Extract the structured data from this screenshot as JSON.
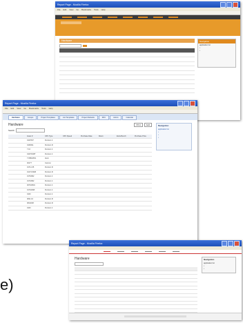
{
  "windows": {
    "top": {
      "title": "Report Page - Mozilla Firefox",
      "menu": [
        "File",
        "Edit",
        "View",
        "Go",
        "Bookmarks",
        "Tools",
        "Help"
      ],
      "section_title": "Hardware",
      "sidebar": {
        "title": "Navigation",
        "items": [
          "application list",
          "",
          ""
        ]
      }
    },
    "middle": {
      "title": "Report Page - Mozilla Firefox",
      "menu": [
        "File",
        "Edit",
        "View",
        "Go",
        "Bookmarks",
        "Tools",
        "Help"
      ],
      "tabs": [
        "Hardware",
        "Groups",
        "Project Templates",
        "List Templates",
        "Project Defaults",
        "RFC",
        "Admin",
        "Calendar"
      ],
      "section_title": "Hardware",
      "search_label": "Search",
      "buttons": {
        "print": "Print",
        "add": "Add"
      },
      "sidebar": {
        "title": "Navigation",
        "items": [
          "application list",
          "",
          "",
          ""
        ]
      },
      "columns": [
        "",
        "Asset #",
        "CPU Type",
        "CPU Speed",
        "Purchase Date",
        "Room",
        "Extra Bench",
        "Purchase Price"
      ],
      "rows": [
        [
          "",
          "0107807",
          "Pentium 4",
          "",
          "",
          "",
          "",
          ""
        ],
        [
          "",
          "0108311",
          "Pentium III",
          "",
          "",
          "",
          "",
          ""
        ],
        [
          "",
          "7.16",
          "Pentium 4",
          "",
          "",
          "",
          "",
          ""
        ],
        [
          "",
          "01070645T",
          "Pentium 4",
          "",
          "",
          "",
          "",
          ""
        ],
        [
          "",
          "7:05810651",
          "Atom",
          "",
          "",
          "",
          "",
          ""
        ],
        [
          "",
          "00177",
          "Celeron",
          "",
          "",
          "",
          "",
          ""
        ],
        [
          "",
          "01711:35",
          "Pentium III",
          "",
          "",
          "",
          "",
          ""
        ],
        [
          "",
          "01174:6498",
          "Pentium III",
          "",
          "",
          "",
          "",
          ""
        ],
        [
          "",
          "01763M2",
          "Pentium 4",
          "",
          "",
          "",
          "",
          ""
        ],
        [
          "",
          "01703M2",
          "Pentium 4",
          "",
          "",
          "",
          "",
          ""
        ],
        [
          "",
          "007040M1",
          "Pentium 4",
          "",
          "",
          "",
          "",
          ""
        ],
        [
          "",
          "01704098",
          "Pentium 4",
          "",
          "",
          "",
          "",
          ""
        ],
        [
          "",
          "0103",
          "Pentium 4",
          "",
          "",
          "",
          "",
          ""
        ],
        [
          "",
          "0811.16",
          "Pentium III",
          "",
          "",
          "",
          "",
          ""
        ],
        [
          "",
          "0814008",
          "Pentium III",
          "",
          "",
          "",
          "",
          ""
        ],
        [
          "",
          "0103",
          "Pentium 4",
          "",
          "",
          "",
          "",
          ""
        ]
      ]
    },
    "bottom": {
      "title": "Report Page - Mozilla Firefox",
      "section_title": "Hardware",
      "sidebar": {
        "title": "Navigation",
        "items": [
          "application list",
          "",
          ""
        ]
      }
    }
  },
  "partial_text": "e)",
  "colors": {
    "orange": "#e79a2a",
    "titlebar_blue": "#2456c8",
    "tab_blue": "#dbe6f5"
  }
}
